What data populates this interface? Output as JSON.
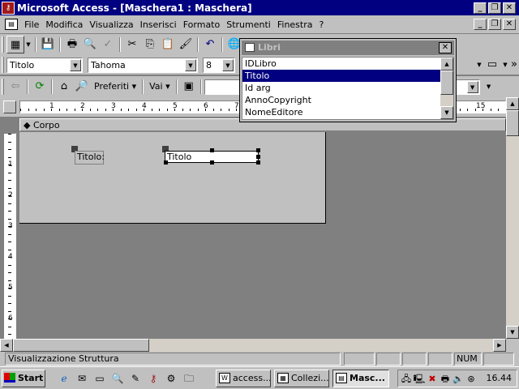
{
  "window": {
    "title": "Microsoft Access - [Maschera1 : Maschera]",
    "app_icon": "access-key-icon",
    "minimize": "_",
    "restore": "❐",
    "close": "✕"
  },
  "menu": {
    "items": [
      "File",
      "Modifica",
      "Visualizza",
      "Inserisci",
      "Formato",
      "Strumenti",
      "Finestra",
      "?"
    ]
  },
  "toolbar_format": {
    "object_combo": "Titolo",
    "font_combo": "Tahoma",
    "size_combo": "8"
  },
  "toolbar_web": {
    "favorites": "Preferiti",
    "go": "Vai",
    "address": ""
  },
  "ruler": {
    "h_marks": [
      "1",
      "2",
      "3",
      "4",
      "5",
      "6",
      "7",
      "15"
    ],
    "v_marks": [
      "1",
      "2",
      "3",
      "4",
      "5",
      "6"
    ]
  },
  "design": {
    "section": "Corpo",
    "label_text": "Titolo:",
    "textbox_text": "Titolo"
  },
  "field_list": {
    "title": "Libri",
    "items": [
      "IDLibro",
      "Titolo",
      "Id arg",
      "AnnoCopyright",
      "NomeEditore"
    ],
    "selected_index": 1
  },
  "status": {
    "text": "Visualizzazione Struttura",
    "num": "NUM"
  },
  "taskbar": {
    "start": "Start",
    "buttons": [
      {
        "label": "access...",
        "icon": "word-doc-icon"
      },
      {
        "label": "Collezi...",
        "icon": "table-icon"
      },
      {
        "label": "Masc...",
        "icon": "form-icon",
        "active": true
      }
    ],
    "clock": "16.44"
  }
}
